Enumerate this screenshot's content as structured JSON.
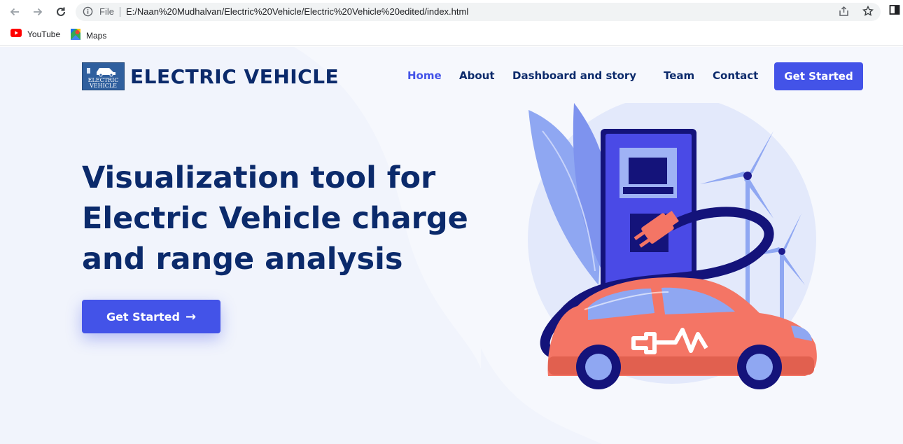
{
  "browser": {
    "file_label": "File",
    "url": "E:/Naan%20Mudhalvan/Electric%20Vehicle/Electric%20Vehicle%20edited/index.html",
    "icons": [
      "back-arrow-icon",
      "forward-arrow-icon",
      "reload-icon",
      "info-icon",
      "share-icon",
      "star-icon",
      "side-panel-icon"
    ],
    "bookmarks": [
      {
        "label": "YouTube",
        "icon": "youtube-icon"
      },
      {
        "label": "Maps",
        "icon": "maps-icon"
      }
    ]
  },
  "site": {
    "brand": {
      "logo_line1": "ELECTRIC",
      "logo_line2": "VEHICLE",
      "name": "ELECTRIC VEHICLE"
    },
    "nav": [
      {
        "label": "Home",
        "active": true
      },
      {
        "label": "About",
        "active": false
      },
      {
        "label": "Dashboard and story",
        "active": false
      },
      {
        "label": "Team",
        "active": false
      },
      {
        "label": "Contact",
        "active": false
      }
    ],
    "nav_cta": "Get Started",
    "hero": {
      "title_lines": [
        "Visualization tool for",
        "Electric Vehicle charge",
        "and range analysis"
      ],
      "cta_label": "Get Started",
      "cta_arrow": "→"
    },
    "illustration": "ev-charging-illustration"
  },
  "colors": {
    "primary": "#4353e8",
    "navy": "#0b2a6b",
    "page_bg": "#f1f4fc",
    "car": "#f47565"
  }
}
